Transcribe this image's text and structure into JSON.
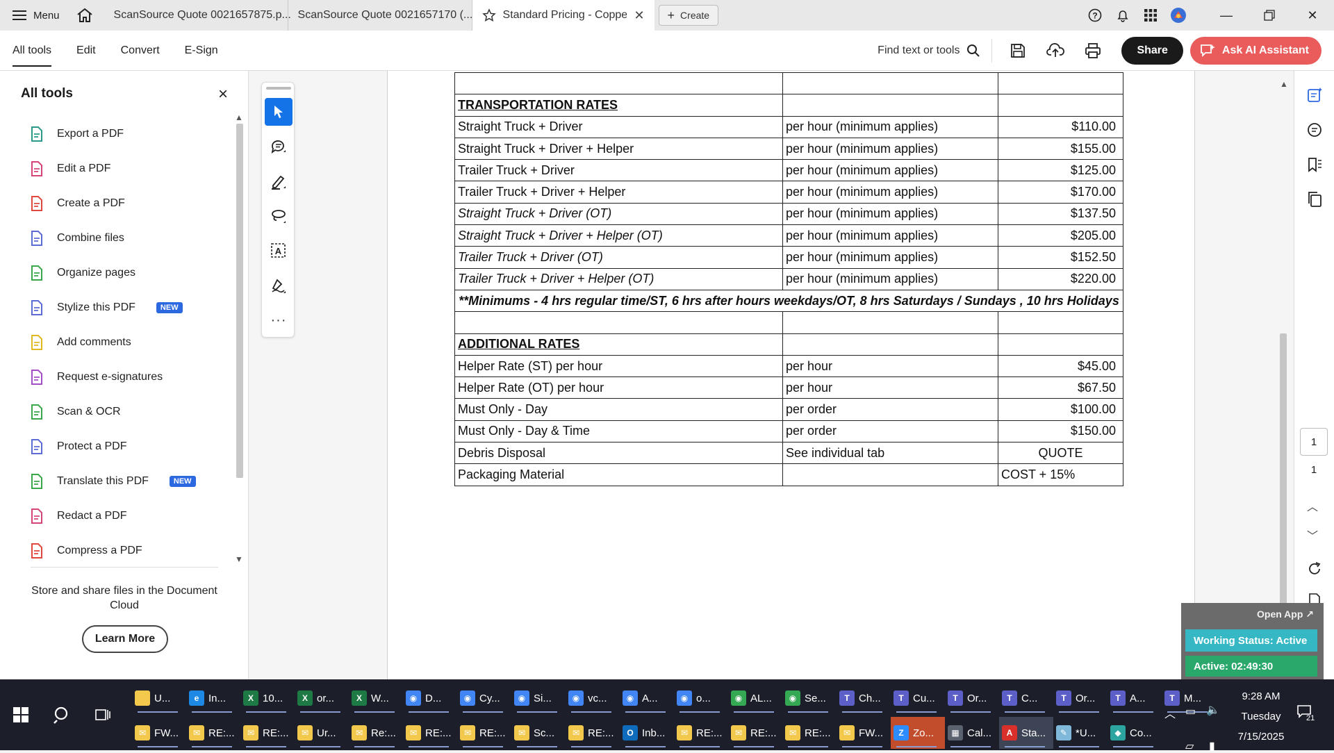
{
  "tabbar": {
    "menu_label": "Menu",
    "tabs": [
      {
        "label": "ScanSource Quote 0021657875.p..."
      },
      {
        "label": "ScanSource Quote 0021657170 (..."
      },
      {
        "label": "Standard Pricing - Coppe..."
      }
    ],
    "create_label": "Create"
  },
  "toolbar": {
    "menu_tabs": [
      "All tools",
      "Edit",
      "Convert",
      "E-Sign"
    ],
    "find_label": "Find text or tools",
    "share_label": "Share",
    "ai_label": "Ask AI Assistant"
  },
  "left_panel": {
    "title": "All tools",
    "items": [
      {
        "label": "Export a PDF",
        "icon": "export-pdf-icon",
        "color": "#2b9a8a"
      },
      {
        "label": "Edit a PDF",
        "icon": "edit-pdf-icon",
        "color": "#d6457a"
      },
      {
        "label": "Create a PDF",
        "icon": "create-pdf-icon",
        "color": "#e0473e"
      },
      {
        "label": "Combine files",
        "icon": "combine-files-icon",
        "color": "#5d6bd6"
      },
      {
        "label": "Organize pages",
        "icon": "organize-pages-icon",
        "color": "#3aa84a"
      },
      {
        "label": "Stylize this PDF",
        "icon": "stylize-pdf-icon",
        "color": "#5d6bd6",
        "badge": "NEW"
      },
      {
        "label": "Add comments",
        "icon": "add-comments-icon",
        "color": "#e0b820"
      },
      {
        "label": "Request e-signatures",
        "icon": "request-esign-icon",
        "color": "#a44fc8"
      },
      {
        "label": "Scan & OCR",
        "icon": "scan-ocr-icon",
        "color": "#3aa84a"
      },
      {
        "label": "Protect a PDF",
        "icon": "protect-pdf-icon",
        "color": "#5d6bd6"
      },
      {
        "label": "Translate this PDF",
        "icon": "translate-pdf-icon",
        "color": "#3aa84a",
        "badge": "NEW"
      },
      {
        "label": "Redact a PDF",
        "icon": "redact-pdf-icon",
        "color": "#d6457a"
      },
      {
        "label": "Compress a PDF",
        "icon": "compress-pdf-icon",
        "color": "#e0473e"
      }
    ],
    "promo_text": "Store and share files in the Document Cloud",
    "learn_more_label": "Learn More"
  },
  "document": {
    "rows": [
      {
        "kind": "blank",
        "c1": "",
        "c2": "",
        "c3": ""
      },
      {
        "kind": "heading",
        "c1": "TRANSPORTATION RATES",
        "c2": "",
        "c3": ""
      },
      {
        "kind": "normal",
        "c1": "Straight Truck + Driver",
        "c2": "per hour (minimum applies)",
        "c3": "$110.00"
      },
      {
        "kind": "normal",
        "c1": "Straight Truck + Driver + Helper",
        "c2": "per hour (minimum applies)",
        "c3": "$155.00"
      },
      {
        "kind": "normal",
        "c1": "Trailer Truck + Driver",
        "c2": "per hour (minimum applies)",
        "c3": "$125.00"
      },
      {
        "kind": "normal",
        "c1": "Trailer Truck + Driver + Helper",
        "c2": "per hour (minimum applies)",
        "c3": "$170.00"
      },
      {
        "kind": "italic",
        "c1": "Straight Truck + Driver (OT)",
        "c2": "per hour (minimum applies)",
        "c3": "$137.50"
      },
      {
        "kind": "italic",
        "c1": "Straight Truck + Driver + Helper (OT)",
        "c2": "per hour (minimum applies)",
        "c3": "$205.00"
      },
      {
        "kind": "italic",
        "c1": "Trailer Truck + Driver (OT)",
        "c2": "per hour (minimum applies)",
        "c3": "$152.50"
      },
      {
        "kind": "italic",
        "c1": "Trailer Truck + Driver + Helper (OT)",
        "c2": "per hour (minimum applies)",
        "c3": "$220.00"
      },
      {
        "kind": "note",
        "c1": "**Minimums -  4 hrs regular time/ST, 6 hrs after hours weekdays/OT, 8 hrs Saturdays / Sundays , 10 hrs Holidays"
      },
      {
        "kind": "blank",
        "c1": "",
        "c2": "",
        "c3": ""
      },
      {
        "kind": "heading",
        "c1": "ADDITIONAL RATES",
        "c2": "",
        "c3": ""
      },
      {
        "kind": "normal",
        "c1": "Helper Rate (ST) per hour",
        "c2": "per hour",
        "c3": "$45.00"
      },
      {
        "kind": "normal",
        "c1": "Helper Rate (OT) per hour",
        "c2": "per hour",
        "c3": "$67.50"
      },
      {
        "kind": "normal",
        "c1": "Must Only - Day",
        "c2": "per order",
        "c3": "$100.00"
      },
      {
        "kind": "normal",
        "c1": "Must Only - Day & Time",
        "c2": "per order",
        "c3": "$150.00"
      },
      {
        "kind": "center",
        "c1": "Debris Disposal",
        "c2": "See individual tab",
        "c3": "QUOTE"
      },
      {
        "kind": "left",
        "c1": "Packaging Material",
        "c2": "",
        "c3": "COST + 15%"
      }
    ]
  },
  "right_rail": {
    "page_current": "1",
    "page_total": "1"
  },
  "widget": {
    "open_app_label": "Open App ↗",
    "working_status": "Working Status: Active",
    "active_timer": "Active: 02:49:30"
  },
  "taskbar": {
    "row1": [
      {
        "label": "U...",
        "icon": "folder-icon",
        "color": "#f2c94c",
        "glyph": ""
      },
      {
        "label": "In...",
        "icon": "edge-icon",
        "color": "#1e88e5",
        "glyph": "e"
      },
      {
        "label": "10...",
        "icon": "excel-icon",
        "color": "#1e7a45",
        "glyph": "X"
      },
      {
        "label": "or...",
        "icon": "excel-icon",
        "color": "#1e7a45",
        "glyph": "X"
      },
      {
        "label": "W...",
        "icon": "excel-icon",
        "color": "#1e7a45",
        "glyph": "X"
      },
      {
        "label": "D...",
        "icon": "chrome-icon",
        "color": "#4285f4",
        "glyph": "◉"
      },
      {
        "label": "Cy...",
        "icon": "chrome-icon",
        "color": "#4285f4",
        "glyph": "◉"
      },
      {
        "label": "Si...",
        "icon": "chrome-icon",
        "color": "#4285f4",
        "glyph": "◉"
      },
      {
        "label": "vc...",
        "icon": "chrome-icon",
        "color": "#4285f4",
        "glyph": "◉"
      },
      {
        "label": "A...",
        "icon": "chrome-icon",
        "color": "#4285f4",
        "glyph": "◉"
      },
      {
        "label": "o...",
        "icon": "chrome-icon",
        "color": "#4285f4",
        "glyph": "◉"
      },
      {
        "label": "AL...",
        "icon": "chrome-icon",
        "color": "#34a853",
        "glyph": "◉"
      },
      {
        "label": "Se...",
        "icon": "chrome-icon",
        "color": "#34a853",
        "glyph": "◉"
      },
      {
        "label": "Ch...",
        "icon": "teams-icon",
        "color": "#5b5fc7",
        "glyph": "T"
      },
      {
        "label": "Cu...",
        "icon": "teams-icon",
        "color": "#5b5fc7",
        "glyph": "T"
      },
      {
        "label": "Or...",
        "icon": "teams-icon",
        "color": "#5b5fc7",
        "glyph": "T"
      },
      {
        "label": "C...",
        "icon": "teams-icon",
        "color": "#5b5fc7",
        "glyph": "T"
      },
      {
        "label": "Or...",
        "icon": "teams-icon",
        "color": "#5b5fc7",
        "glyph": "T"
      },
      {
        "label": "A...",
        "icon": "teams-icon",
        "color": "#5b5fc7",
        "glyph": "T"
      },
      {
        "label": "M...",
        "icon": "teams-icon",
        "color": "#5b5fc7",
        "glyph": "T"
      }
    ],
    "row2": [
      {
        "label": "FW...",
        "icon": "mail-icon",
        "color": "#f2c94c",
        "glyph": "✉"
      },
      {
        "label": "RE:...",
        "icon": "mail-icon",
        "color": "#f2c94c",
        "glyph": "✉"
      },
      {
        "label": "RE:...",
        "icon": "mail-icon",
        "color": "#f2c94c",
        "glyph": "✉"
      },
      {
        "label": "Ur...",
        "icon": "mail-icon",
        "color": "#f2c94c",
        "glyph": "✉"
      },
      {
        "label": "Re:...",
        "icon": "mail-icon",
        "color": "#f2c94c",
        "glyph": "✉"
      },
      {
        "label": "RE:...",
        "icon": "mail-icon",
        "color": "#f2c94c",
        "glyph": "✉"
      },
      {
        "label": "RE:...",
        "icon": "mail-icon",
        "color": "#f2c94c",
        "glyph": "✉"
      },
      {
        "label": "Sc...",
        "icon": "mail-icon",
        "color": "#f2c94c",
        "glyph": "✉"
      },
      {
        "label": "RE:...",
        "icon": "mail-icon",
        "color": "#f2c94c",
        "glyph": "✉"
      },
      {
        "label": "Inb...",
        "icon": "outlook-icon",
        "color": "#0f6cbd",
        "glyph": "O"
      },
      {
        "label": "RE:...",
        "icon": "mail-icon",
        "color": "#f2c94c",
        "glyph": "✉"
      },
      {
        "label": "RE:...",
        "icon": "mail-icon",
        "color": "#f2c94c",
        "glyph": "✉"
      },
      {
        "label": "RE:...",
        "icon": "mail-icon",
        "color": "#f2c94c",
        "glyph": "✉"
      },
      {
        "label": "FW...",
        "icon": "mail-icon",
        "color": "#f2c94c",
        "glyph": "✉"
      },
      {
        "label": "Zo...",
        "icon": "zoom-icon",
        "color": "#2d8cff",
        "glyph": "Z",
        "highlight": "hl"
      },
      {
        "label": "Cal...",
        "icon": "calculator-icon",
        "color": "#5a6270",
        "glyph": "▦"
      },
      {
        "label": "Sta...",
        "icon": "acrobat-icon",
        "color": "#d9302c",
        "glyph": "A",
        "highlight": "hl2"
      },
      {
        "label": "*U...",
        "icon": "notepad-icon",
        "color": "#7fb8d9",
        "glyph": "✎"
      },
      {
        "label": "Co...",
        "icon": "copilot-icon",
        "color": "#2ca5a0",
        "glyph": "◆"
      }
    ],
    "time": "9:28 AM",
    "day": "Tuesday",
    "date": "7/15/2025",
    "notification_count": "21"
  }
}
